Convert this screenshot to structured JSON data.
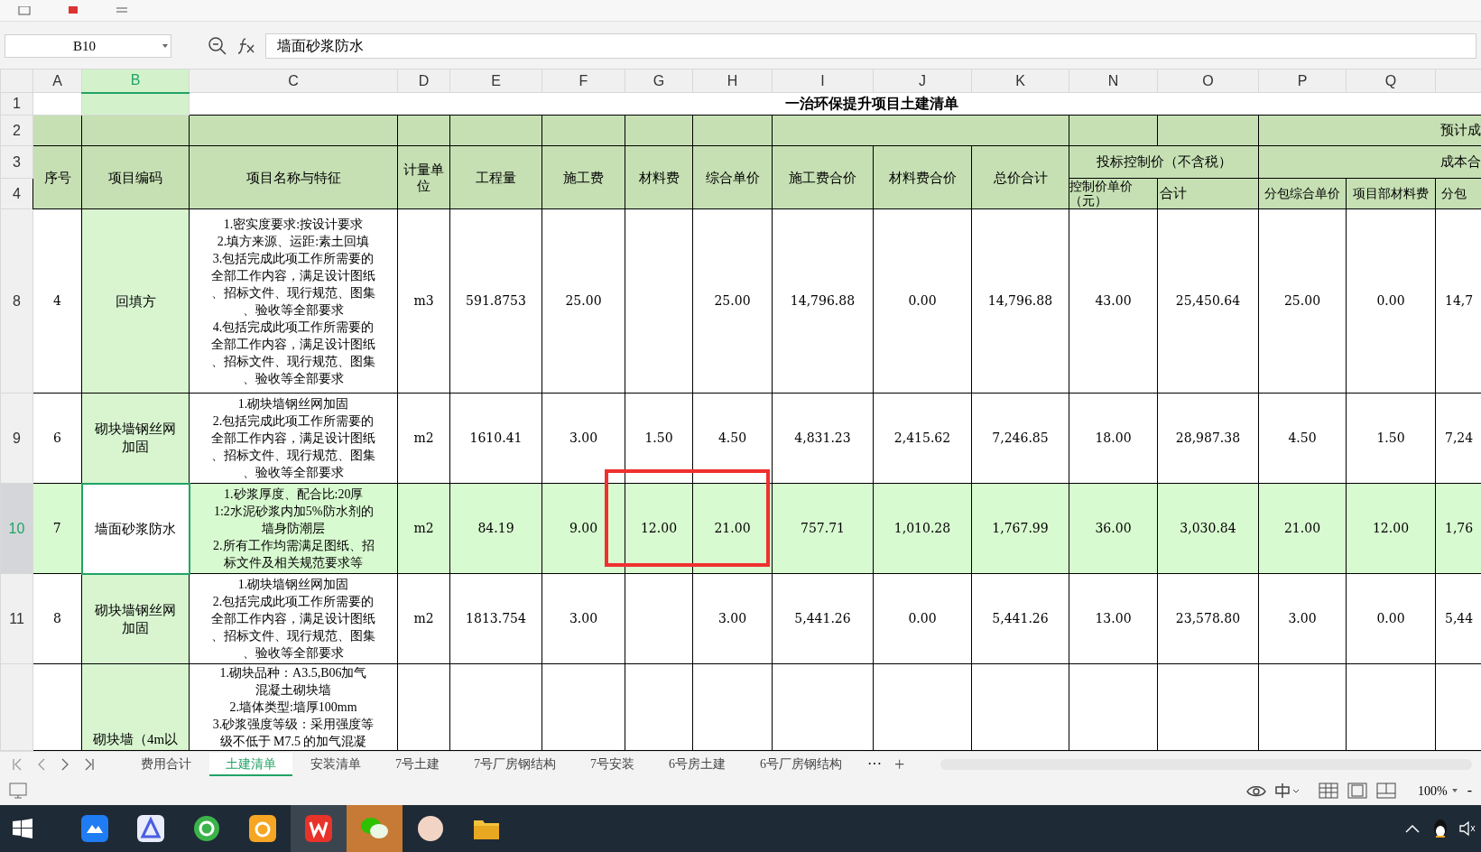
{
  "name_box": "B10",
  "formula": "墙面砂浆防水",
  "columns": [
    {
      "label": "A",
      "selected": false
    },
    {
      "label": "B",
      "selected": true
    },
    {
      "label": "C",
      "selected": false
    },
    {
      "label": "D",
      "selected": false
    },
    {
      "label": "E",
      "selected": false
    },
    {
      "label": "F",
      "selected": false
    },
    {
      "label": "G",
      "selected": false
    },
    {
      "label": "H",
      "selected": false
    },
    {
      "label": "I",
      "selected": false
    },
    {
      "label": "J",
      "selected": false
    },
    {
      "label": "K",
      "selected": false
    },
    {
      "label": "N",
      "selected": false
    },
    {
      "label": "O",
      "selected": false
    },
    {
      "label": "P",
      "selected": false
    },
    {
      "label": "Q",
      "selected": false
    }
  ],
  "header_rows": [
    "1",
    "2",
    "3",
    "4"
  ],
  "title": "一治环保提升项目土建清单",
  "header": {
    "cost_group_top": "预计成",
    "labels": [
      "序号",
      "项目编码",
      "项目名称与特征",
      "计量单位",
      "工程量",
      "施工费",
      "材料费",
      "综合单价",
      "施工费合价",
      "材料费合价",
      "总价合计"
    ],
    "bid_control": "投标控制价（不含税）",
    "bid_unit_price": "控制价单价（元）",
    "bid_total": "合计",
    "cost_group": "成本合",
    "cost_columns": [
      "分包综合单价",
      "项目部材料费",
      "分包"
    ]
  },
  "rows": [
    {
      "row_number": "8",
      "selected": false,
      "seq": "4",
      "code": "回填方",
      "description_lines": [
        "1.密实度要求:按设计要求",
        "2.填方来源、运距:素土回填",
        "3.包括完成此项工作所需要的",
        "全部工作内容，满足设计图纸",
        "、招标文件、现行规范、图集",
        "、验收等全部要求",
        "4.包括完成此项工作所需要的",
        "全部工作内容，满足设计图纸",
        "、招标文件、现行规范、图集",
        "、验收等全部要求"
      ],
      "unit": "m3",
      "quantity": "591.8753",
      "labor": "25.00",
      "unit_price": "25.00",
      "labor_total": "14,796.88",
      "material_total": "0.00",
      "total": "14,796.88",
      "control_unit_price": "43.00",
      "control_total": "25,450.64",
      "sub_unit_price": "25.00",
      "dept_material": "0.00",
      "sub_total": "14,7"
    },
    {
      "row_number": "9",
      "selected": false,
      "seq": "6",
      "code": "砌块墙钢丝网加固",
      "description_lines": [
        "1.砌块墙钢丝网加固",
        "2.包括完成此项工作所需要的",
        "全部工作内容，满足设计图纸",
        "、招标文件、现行规范、图集",
        "、验收等全部要求"
      ],
      "unit": "m2",
      "quantity": "1610.41",
      "labor": "3.00",
      "material": "1.50",
      "unit_price": "4.50",
      "labor_total": "4,831.23",
      "material_total": "2,415.62",
      "total": "7,246.85",
      "control_unit_price": "18.00",
      "control_total": "28,987.38",
      "sub_unit_price": "4.50",
      "dept_material": "1.50",
      "sub_total": "7,24"
    },
    {
      "row_number": "10",
      "selected": true,
      "seq": "7",
      "code": "墙面砂浆防水",
      "description_lines": [
        "1.砂浆厚度、配合比:20厚",
        "1:2水泥砂浆内加5%防水剂的",
        "墙身防潮层",
        "2.所有工作均需满足图纸、招",
        "标文件及相关规范要求等"
      ],
      "unit": "m2",
      "quantity": "84.19",
      "labor": "9.00",
      "material": "12.00",
      "unit_price": "21.00",
      "labor_total": "757.71",
      "material_total": "1,010.28",
      "total": "1,767.99",
      "control_unit_price": "36.00",
      "control_total": "3,030.84",
      "sub_unit_price": "21.00",
      "dept_material": "12.00",
      "sub_total": "1,76"
    },
    {
      "row_number": "11",
      "selected": false,
      "seq": "8",
      "code": "砌块墙钢丝网加固",
      "description_lines": [
        "1.砌块墙钢丝网加固",
        "2.包括完成此项工作所需要的",
        "全部工作内容，满足设计图纸",
        "、招标文件、现行规范、图集",
        "、验收等全部要求"
      ],
      "unit": "m2",
      "quantity": "1813.754",
      "labor": "3.00",
      "unit_price": "3.00",
      "labor_total": "5,441.26",
      "material_total": "0.00",
      "total": "5,441.26",
      "control_unit_price": "13.00",
      "control_total": "23,578.80",
      "sub_unit_price": "3.00",
      "dept_material": "0.00",
      "sub_total": "5,44"
    },
    {
      "selected": false,
      "code": "砌块墙（4m以",
      "description_lines": [
        "1.砌块品种：A3.5,B06加气",
        "混凝土砌块墙",
        "2.墙体类型:墙厚100mm",
        "3.砂浆强度等级：采用强度等",
        "级不低于 M7.5 的加气混凝"
      ]
    }
  ],
  "sheet_tabs": [
    {
      "label": "费用合计",
      "selected": false
    },
    {
      "label": "土建清单",
      "selected": true
    },
    {
      "label": "安装清单",
      "selected": false
    },
    {
      "label": "7号土建",
      "selected": false
    },
    {
      "label": "7号厂房钢结构",
      "selected": false
    },
    {
      "label": "7号安装",
      "selected": false
    },
    {
      "label": "6号房土建",
      "selected": false
    },
    {
      "label": "6号厂房钢结构",
      "selected": false
    }
  ],
  "more_tabs": "···",
  "add_tab": "+",
  "zoom": "100%",
  "zoom_out": "-"
}
